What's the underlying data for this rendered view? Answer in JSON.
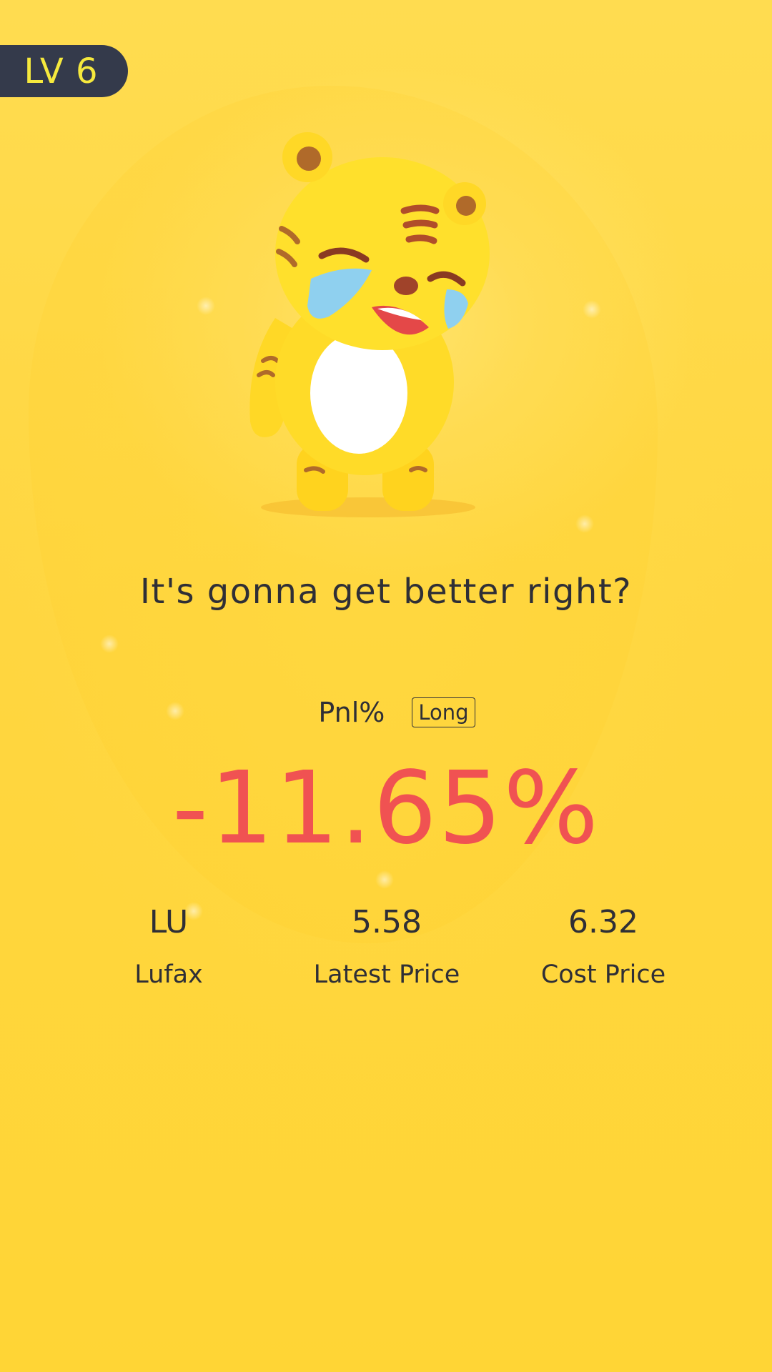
{
  "level_badge": {
    "label": "LV 6"
  },
  "mascot": {
    "icon": "crying-tiger-mascot"
  },
  "headline": "It's gonna get better right?",
  "pnl": {
    "label": "Pnl%",
    "position_tag": "Long",
    "value": "-11.65%",
    "value_color": "#f05252"
  },
  "stats": [
    {
      "value": "LU",
      "label": "Lufax"
    },
    {
      "value": "5.58",
      "label": "Latest Price"
    },
    {
      "value": "6.32",
      "label": "Cost Price"
    }
  ],
  "colors": {
    "background": "#ffd63c",
    "badge_bg": "#343a4b",
    "badge_text": "#f6e93d",
    "text": "#2f2f36"
  }
}
